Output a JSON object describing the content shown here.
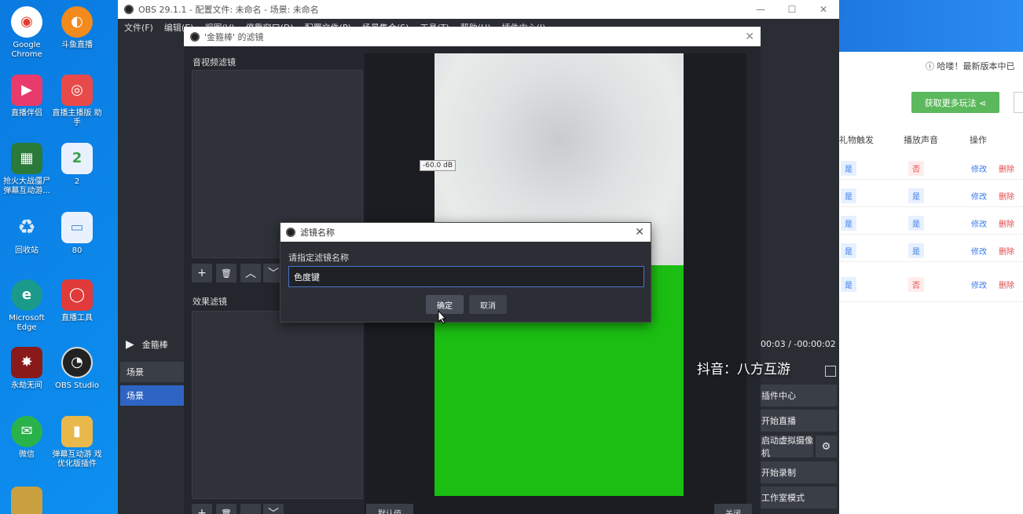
{
  "desktop": {
    "icons": [
      {
        "label": "Google Chrome",
        "glyph": "◉",
        "color": "#e33b2e"
      },
      {
        "label": "斗鱼直播",
        "glyph": "◐",
        "color": "#f28a1e"
      },
      {
        "label": "直播伴侣",
        "glyph": "▶",
        "color": "#e83a6b"
      },
      {
        "label": "直播主播版 助手",
        "glyph": "◎",
        "color": "#e84a4a"
      },
      {
        "label": "抢火大战僵尸 弹幕互动游...",
        "glyph": "▦",
        "color": "#2a7a3a"
      },
      {
        "label": "2",
        "glyph": "2",
        "color": "#3aa04a"
      },
      {
        "label": "回收站",
        "glyph": "♻",
        "color": "#6aaee8"
      },
      {
        "label": "80",
        "glyph": "▭",
        "color": "#4a90d8"
      },
      {
        "label": "Microsoft Edge",
        "glyph": "e",
        "color": "#1a9a8a"
      },
      {
        "label": "直播工具",
        "glyph": "◯",
        "color": "#e03a3a"
      },
      {
        "label": "永劫无间",
        "glyph": "✸",
        "color": "#8a1a1a"
      },
      {
        "label": "OBS Studio",
        "glyph": "◔",
        "color": "#222"
      },
      {
        "label": "微信",
        "glyph": "✉",
        "color": "#2ab24a"
      },
      {
        "label": "弹幕互动游 戏优化版插件",
        "glyph": "▮",
        "color": "#e8b84a"
      }
    ]
  },
  "webapp": {
    "notice": "哈喽！最新版本中已",
    "more_button": "获取更多玩法 ⋖",
    "headers": {
      "col1": "礼物触发",
      "col2": "播放声音",
      "col3": "操作"
    },
    "rows": [
      {
        "c1": "是",
        "c2": "否",
        "edit": "修改",
        "del": "删除"
      },
      {
        "c1": "是",
        "c2": "是",
        "edit": "修改",
        "del": "删除"
      },
      {
        "c1": "是",
        "c2": "是",
        "edit": "修改",
        "del": "删除"
      },
      {
        "c1": "是",
        "c2": "是",
        "edit": "修改",
        "del": "删除"
      },
      {
        "c1": "是",
        "c2": "否",
        "edit": "修改",
        "del": "删除"
      }
    ]
  },
  "obs": {
    "title": "OBS 29.1.1 - 配置文件: 未命名 - 场景: 未命名",
    "menu": [
      "文件(F)",
      "编辑(E)",
      "视图(V)",
      "停靠窗口(D)",
      "配置文件(P)",
      "场景集合(S)",
      "工具(T)",
      "帮助(H)",
      "插件中心(J)"
    ],
    "source_label": "金箍棒",
    "scene_header": "场景",
    "scene_selected": "场景",
    "time_display": "00:03 / -00:00:02",
    "controls": [
      "插件中心",
      "开始直播",
      "启动虚拟摄像机",
      "开始录制",
      "工作室模式"
    ],
    "window_controls": [
      "—",
      "☐",
      "✕"
    ]
  },
  "filters_window": {
    "title": "'金箍棒' 的滤镜",
    "audio_video_label": "音视频滤镜",
    "effects_label": "效果滤镜",
    "db_label": "-60.0 dB",
    "defaults_button": "默认值",
    "close_button": "关闭",
    "tool_glyphs": {
      "add": "+",
      "remove": "🗑",
      "up": "︿",
      "down": "﹀"
    }
  },
  "dialog": {
    "title": "滤镜名称",
    "prompt": "请指定滤镜名称",
    "value": "色度键",
    "ok": "确定",
    "cancel": "取消"
  },
  "watermark": "抖音：八方互游"
}
